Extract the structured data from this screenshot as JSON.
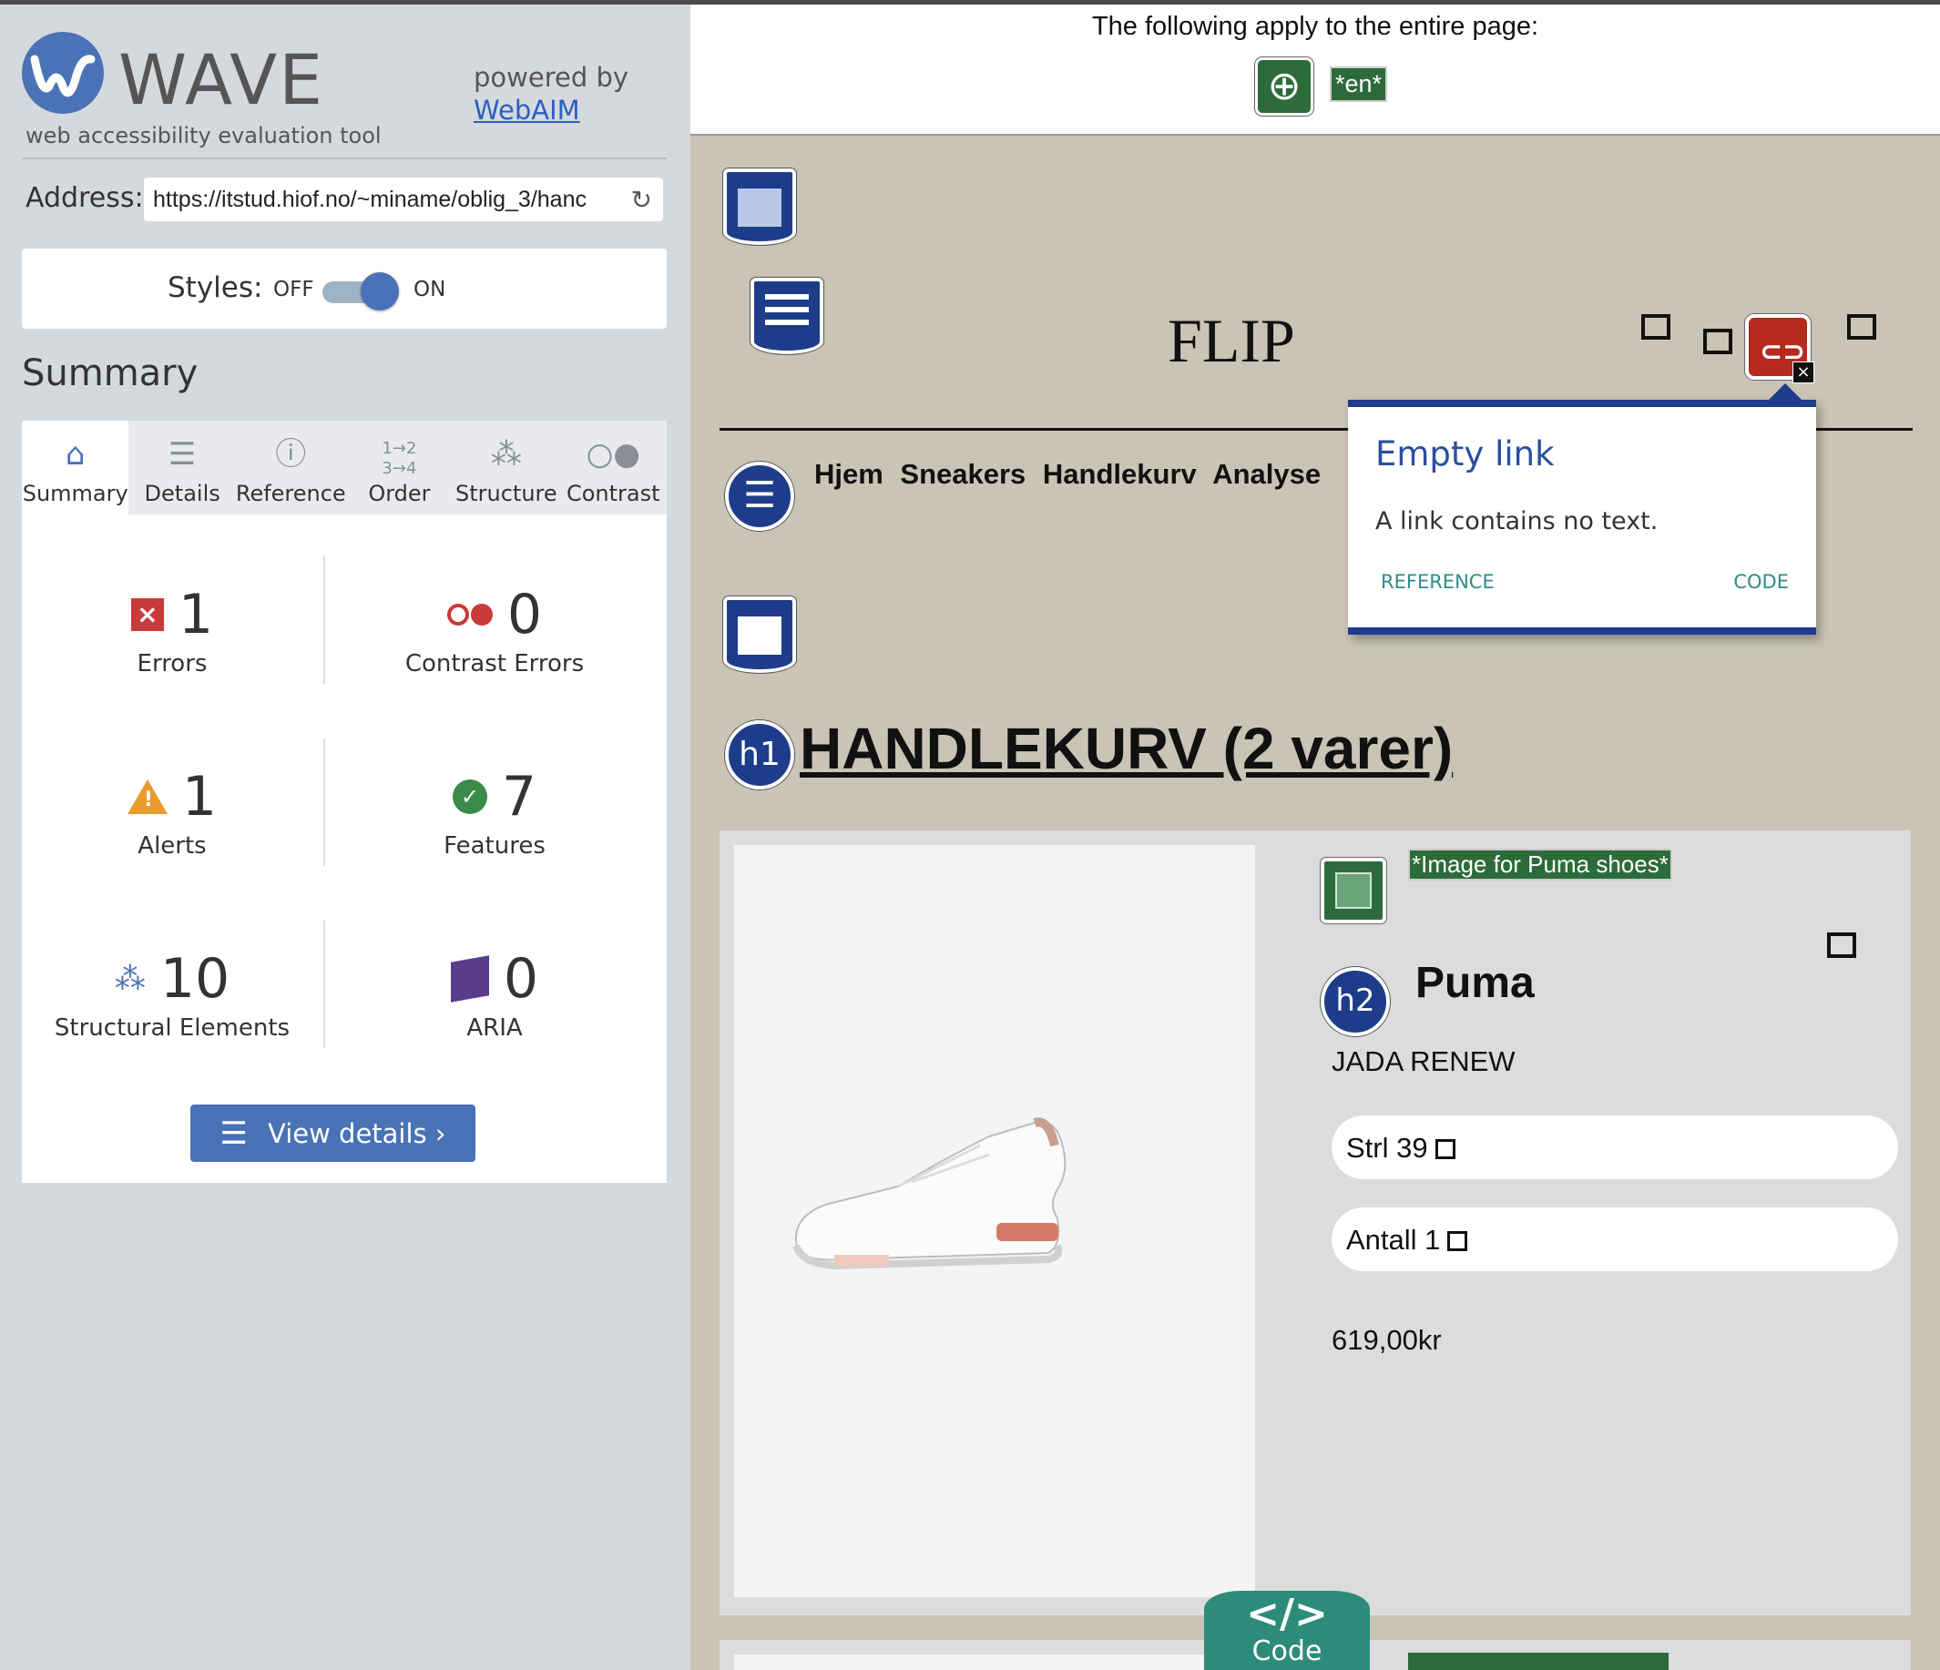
{
  "wave": {
    "title": "WAVE",
    "subtitle": "web accessibility evaluation tool",
    "powered_by": "powered by",
    "webaim_link": "WebAIM",
    "address_label": "Address:",
    "address_value": "https://itstud.hiof.no/~miname/oblig_3/hanc",
    "styles_label": "Styles:",
    "styles_off": "OFF",
    "styles_on": "ON",
    "styles_state": "ON",
    "summary_heading": "Summary",
    "tabs": [
      {
        "label": "Summary",
        "icon": "home-icon",
        "active": true
      },
      {
        "label": "Details",
        "icon": "list-icon",
        "active": false
      },
      {
        "label": "Reference",
        "icon": "info-icon",
        "active": false
      },
      {
        "label": "Order",
        "icon": "order-icon",
        "active": false
      },
      {
        "label": "Structure",
        "icon": "structure-icon",
        "active": false
      },
      {
        "label": "Contrast",
        "icon": "contrast-icon",
        "active": false
      }
    ],
    "stats": {
      "errors": {
        "count": "1",
        "label": "Errors"
      },
      "contrast_errors": {
        "count": "0",
        "label": "Contrast Errors"
      },
      "alerts": {
        "count": "1",
        "label": "Alerts"
      },
      "features": {
        "count": "7",
        "label": "Features"
      },
      "structural": {
        "count": "10",
        "label": "Structural Elements"
      },
      "aria": {
        "count": "0",
        "label": "ARIA"
      }
    },
    "view_details": "View details ›",
    "colors": {
      "accent": "#4a72b6",
      "error": "#c93a3a",
      "alert": "#e89b2c",
      "feature": "#3a8a4a",
      "aria": "#5a3c8c"
    }
  },
  "page": {
    "apply_text": "The following apply to the entire page:",
    "lang_badge": "*en*",
    "site_title": "FLIP",
    "nav_links": "Hjem Sneakers Handlekurv Analyse",
    "popup": {
      "title": "Empty link",
      "description": "A link contains no text.",
      "reference": "REFERENCE",
      "code": "CODE"
    },
    "h1_badge": "h1",
    "h1_text": "HANDLEKURV (2 varer)",
    "product": {
      "alt_text": "*Image for Puma shoes*",
      "h2_badge": "h2",
      "brand": "Puma",
      "model": "JADA RENEW",
      "size": "Strl 39",
      "quantity": "Antall 1",
      "price": "619,00kr"
    },
    "code_tab_symbol": "</>",
    "code_tab_label": "Code"
  }
}
